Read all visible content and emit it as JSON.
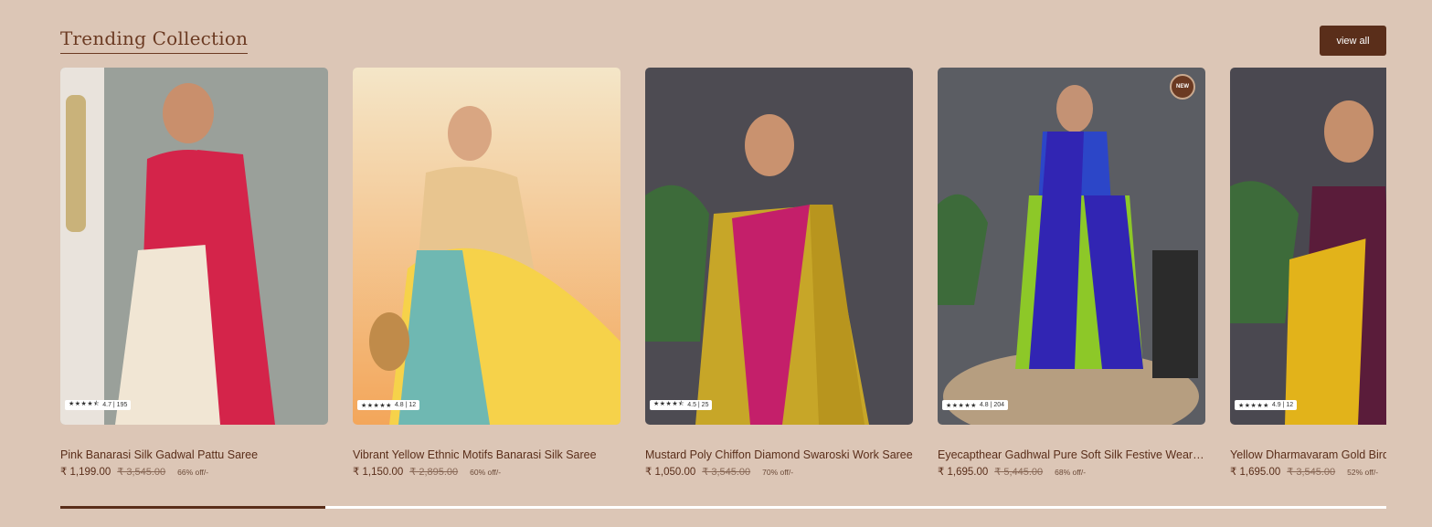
{
  "section": {
    "title": "Trending Collection",
    "view_all_label": "view all"
  },
  "products": [
    {
      "name": "Pink Banarasi Silk Gadwal Pattu Saree",
      "price": "₹ 1,199.00",
      "mrp": "₹ 3,545.00",
      "discount": "66% off/-",
      "rating": "4.7 | 195",
      "stars": "★★★★⯪",
      "image_colors": [
        "#9aa09a",
        "#f1e6d4",
        "#d4244a",
        "#c9b27a"
      ]
    },
    {
      "name": "Vibrant Yellow Ethnic Motifs Banarasi Silk Saree",
      "price": "₹ 1,150.00",
      "mrp": "₹ 2,895.00",
      "discount": "60% off/-",
      "rating": "4.8 | 12",
      "stars": "★★★★★",
      "image_colors": [
        "#f3a65a",
        "#f6d24a",
        "#6fb8b2",
        "#e8c58f"
      ]
    },
    {
      "name": "Mustard Poly Chiffon Diamond Swaroski Work Saree",
      "price": "₹ 1,050.00",
      "mrp": "₹ 3,545.00",
      "discount": "70% off/-",
      "rating": "4.5 | 25",
      "stars": "★★★★⯪",
      "image_colors": [
        "#4d4b52",
        "#c7a628",
        "#c41f6a",
        "#3d6b3a"
      ]
    },
    {
      "name": "Eyecapthear Gadhwal Pure Soft Silk Festive Wear Saree",
      "price": "₹ 1,695.00",
      "mrp": "₹ 5,445.00",
      "discount": "68% off/-",
      "rating": "4.8 | 204",
      "stars": "★★★★★",
      "image_colors": [
        "#5b5d63",
        "#8dc828",
        "#3125b3",
        "#b69e80"
      ],
      "badge": "NEW"
    },
    {
      "name": "Yellow Dharmavaram Gold Birds",
      "price": "₹ 1,695.00",
      "mrp": "₹ 3,545.00",
      "discount": "52% off/-",
      "rating": "4.9 | 12",
      "stars": "★★★★★",
      "image_colors": [
        "#4a4850",
        "#e2b31a",
        "#5a1c3a",
        "#3d6b3a"
      ]
    }
  ],
  "slider": {
    "progress": 0.2
  }
}
